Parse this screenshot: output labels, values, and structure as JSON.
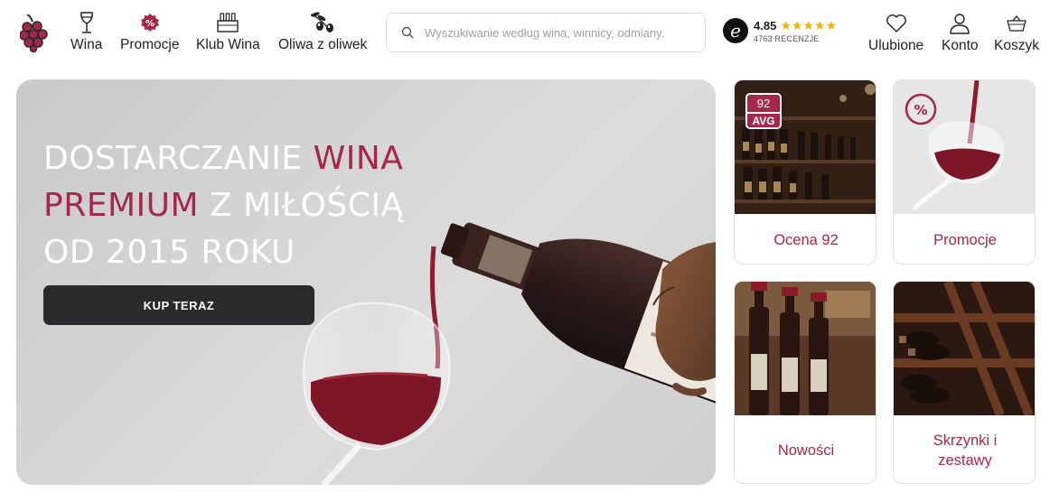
{
  "nav": {
    "items": [
      {
        "label": "Wina",
        "icon": "wine-glass-icon"
      },
      {
        "label": "Promocje",
        "icon": "percent-badge-icon"
      },
      {
        "label": "Klub Wina",
        "icon": "wine-box-icon"
      },
      {
        "label": "Oliwa z oliwek",
        "icon": "olive-branch-icon"
      }
    ]
  },
  "search": {
    "placeholder": "Wyszukiwanie według wina, winnicy, odmiany."
  },
  "rating": {
    "badge": "e",
    "score": "4.85",
    "stars": "★★★★★",
    "count": "4763 RECENZJE"
  },
  "utility": {
    "favorites_label": "Ulubione",
    "account_label": "Konto",
    "cart_label": "Koszyk"
  },
  "hero": {
    "line1_white": "DOSTARCZANIE ",
    "line1_accent": "WINA",
    "line2_accent": "PREMIUM",
    "line2_white": " Z MIŁOŚCIĄ",
    "line3_white": "OD 2015 ROKU",
    "cta_label": "KUP TERAZ"
  },
  "cards": [
    {
      "label": "Ocena 92",
      "badge_number": "92",
      "badge_text": "AVG"
    },
    {
      "label": "Promocje"
    },
    {
      "label": "Nowości"
    },
    {
      "label": "Skrzynki i zestawy"
    }
  ],
  "colors": {
    "accent": "#a5284a",
    "button_dark": "#2a2a2c",
    "star": "#f5b301"
  }
}
